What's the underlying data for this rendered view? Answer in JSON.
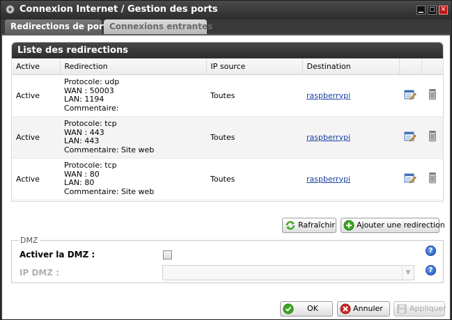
{
  "window": {
    "title": "Connexion Internet / Gestion des ports",
    "controls": {
      "minimize": "▁",
      "maximize": "□",
      "close": "✕"
    }
  },
  "tabs": [
    {
      "label": "Redirections de ports",
      "active": true
    },
    {
      "label": "Connexions entrantes",
      "active": false
    }
  ],
  "panel": {
    "title": "Liste des redirections",
    "columns": [
      "Active",
      "Redirection",
      "IP source",
      "Destination",
      "",
      ""
    ],
    "rows": [
      {
        "active": "Active",
        "protocol": "Protocole: udp",
        "wan": "WAN : 50003",
        "lan": "LAN: 1194",
        "comment": "Commentaire:",
        "ip_source": "Toutes",
        "destination": "raspberrypi"
      },
      {
        "active": "Active",
        "protocol": "Protocole: tcp",
        "wan": "WAN : 443",
        "lan": "LAN: 443",
        "comment": "Commentaire: Site web",
        "ip_source": "Toutes",
        "destination": "raspberrypi"
      },
      {
        "active": "Active",
        "protocol": "Protocole: tcp",
        "wan": "WAN : 80",
        "lan": "LAN: 80",
        "comment": "Commentaire: Site web",
        "ip_source": "Toutes",
        "destination": "raspberrypi"
      }
    ]
  },
  "actions": {
    "refresh_label": "Rafraîchir",
    "add_label": "Ajouter une redirection"
  },
  "dmz": {
    "legend": "DMZ",
    "enable_label": "Activer la DMZ :",
    "enabled": false,
    "ip_label": "IP DMZ :",
    "ip_value": "",
    "help_symbol": "?"
  },
  "footer": {
    "ok_label": "OK",
    "cancel_label": "Annuler",
    "apply_label": "Appliquer"
  },
  "colors": {
    "titlebar": "#2c2c2c",
    "link": "#1a3fa0",
    "ok_icon": "#3aa61e",
    "cancel_icon": "#d22a2a"
  }
}
